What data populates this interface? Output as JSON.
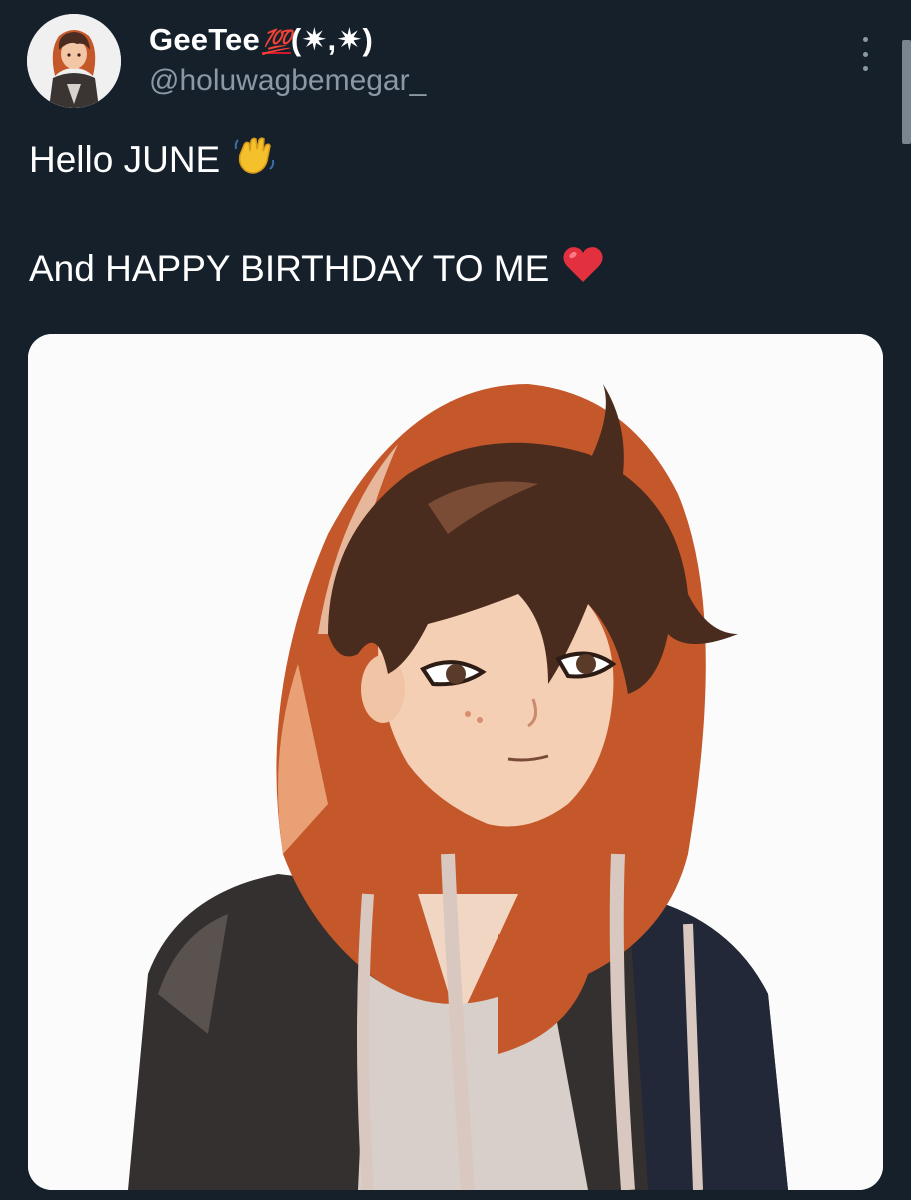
{
  "tweet": {
    "author": {
      "display_name": "GeeTee",
      "name_emoji": "💯",
      "name_suffix": "(✷,✷)",
      "handle": "@holuwagbemegar_"
    },
    "lines": [
      {
        "text": "Hello JUNE",
        "emoji": "waving-hand-icon"
      },
      {
        "text": "And HAPPY BIRTHDAY TO ME",
        "emoji": "red-heart-icon"
      }
    ],
    "media": {
      "kind": "illustration",
      "subject": "anime-boy-orange-hoodie"
    }
  },
  "colors": {
    "background": "#15202b",
    "text": "#ffffff",
    "secondary_text": "#8b98a5",
    "hundred_emoji": "#d0182f",
    "heart": "#e3303f",
    "wave": "#f4c02c"
  }
}
